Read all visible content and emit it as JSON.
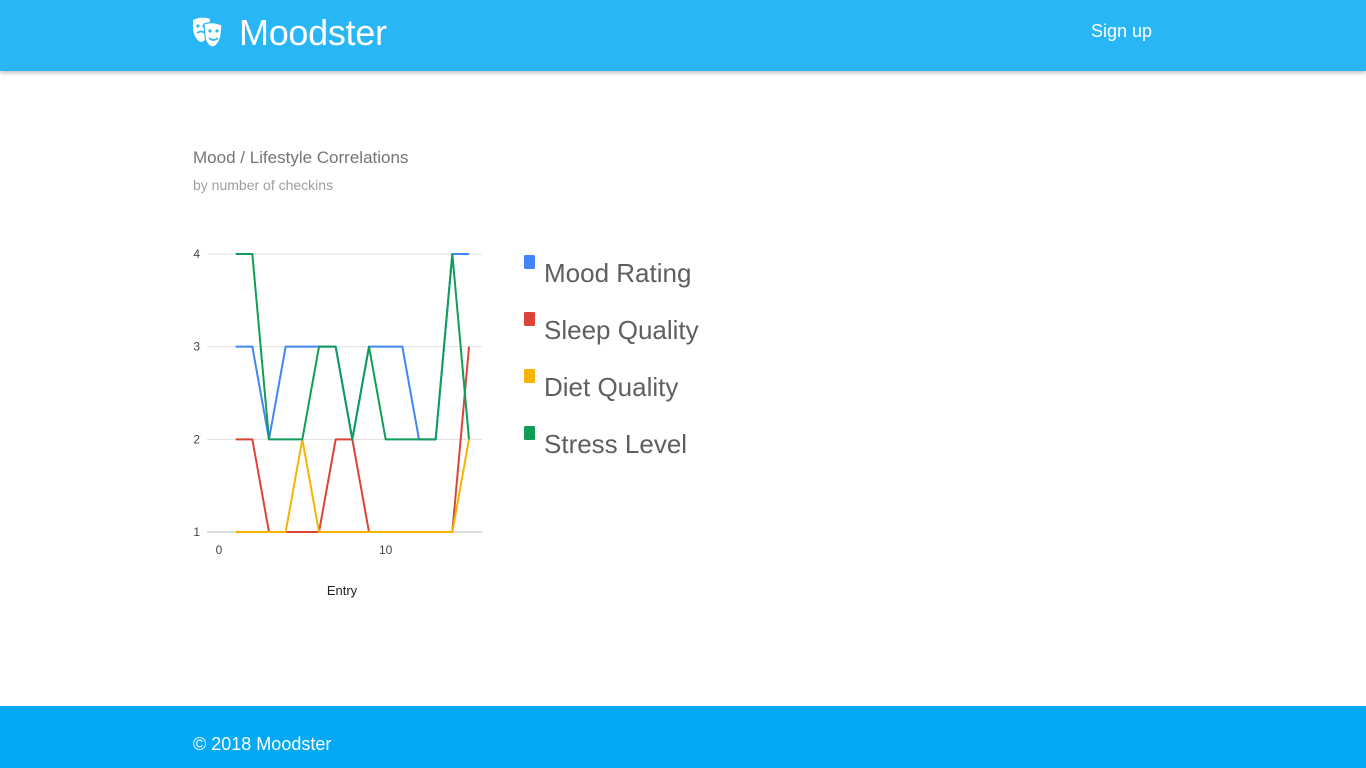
{
  "header": {
    "brand_name": "Moodster",
    "brand_icon": "theater-masks-icon",
    "signup_label": "Sign up",
    "bg_color": "#29b6f6"
  },
  "main": {
    "chart_title": "Mood / Lifestyle Correlations",
    "chart_subtitle": "by number of checkins"
  },
  "chart_data": {
    "type": "line",
    "title": "Mood / Lifestyle Correlations",
    "subtitle": "by number of checkins",
    "xlabel": "Entry",
    "ylabel": "",
    "xlim": [
      0,
      15
    ],
    "ylim": [
      1,
      4
    ],
    "x_ticks": [
      0,
      10
    ],
    "y_ticks": [
      1,
      2,
      3,
      4
    ],
    "grid": true,
    "legend_position": "right",
    "x": [
      1,
      2,
      3,
      4,
      5,
      6,
      7,
      8,
      9,
      10,
      11,
      12,
      13,
      14,
      15
    ],
    "series": [
      {
        "name": "Mood Rating",
        "color": "#4285f4",
        "values": [
          3,
          3,
          2,
          3,
          3,
          3,
          3,
          2,
          3,
          3,
          3,
          2,
          2,
          4,
          4
        ]
      },
      {
        "name": "Sleep Quality",
        "color": "#db4437",
        "values": [
          2,
          2,
          1,
          1,
          1,
          1,
          2,
          2,
          1,
          1,
          1,
          1,
          1,
          1,
          3
        ]
      },
      {
        "name": "Diet Quality",
        "color": "#f4b400",
        "values": [
          1,
          1,
          1,
          1,
          2,
          1,
          1,
          1,
          1,
          1,
          1,
          1,
          1,
          1,
          2
        ]
      },
      {
        "name": "Stress Level",
        "color": "#0f9d58",
        "values": [
          4,
          4,
          2,
          2,
          2,
          3,
          3,
          2,
          3,
          2,
          2,
          2,
          2,
          4,
          2
        ]
      }
    ]
  },
  "footer": {
    "copyright": "© 2018 Moodster",
    "bg_color": "#03a9f4"
  }
}
